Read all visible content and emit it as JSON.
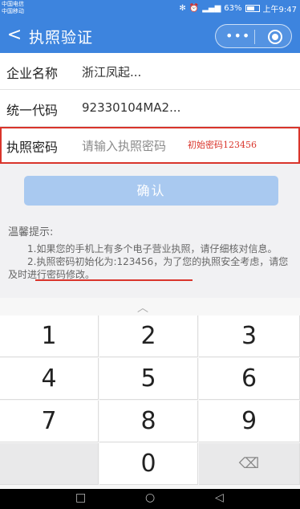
{
  "status_bar": {
    "carrier_1": "中国电信",
    "carrier_2": "中国移动",
    "battery": "63%",
    "time": "上午9:47"
  },
  "navbar": {
    "back_label": "<",
    "title": "执照验证",
    "menu_label": "•••"
  },
  "form": {
    "company_label": "企业名称",
    "company_value": "浙江凤起...",
    "code_label": "统一代码",
    "code_value": "92330104MA2...",
    "password_label": "执照密码",
    "password_placeholder": "请输入执照密码",
    "password_note": "初始密码123456"
  },
  "confirm_button": "确认",
  "tips": {
    "title": "温馨提示:",
    "line1": "1.如果您的手机上有多个电子营业执照，请仔细核对信息。",
    "line2": "2.执照密码初始化为:123456，为了您的执照安全考虑，请您及时进行密码修改。"
  },
  "keyboard": {
    "handle": "︿",
    "keys": [
      "1",
      "2",
      "3",
      "4",
      "5",
      "6",
      "7",
      "8",
      "9",
      "",
      "0",
      "⌫"
    ]
  },
  "system_nav": {
    "recent": "□",
    "home": "○",
    "back": "◁"
  },
  "colors": {
    "primary": "#3d84de",
    "button": "#a9c9f0",
    "highlight": "#d9342b"
  }
}
